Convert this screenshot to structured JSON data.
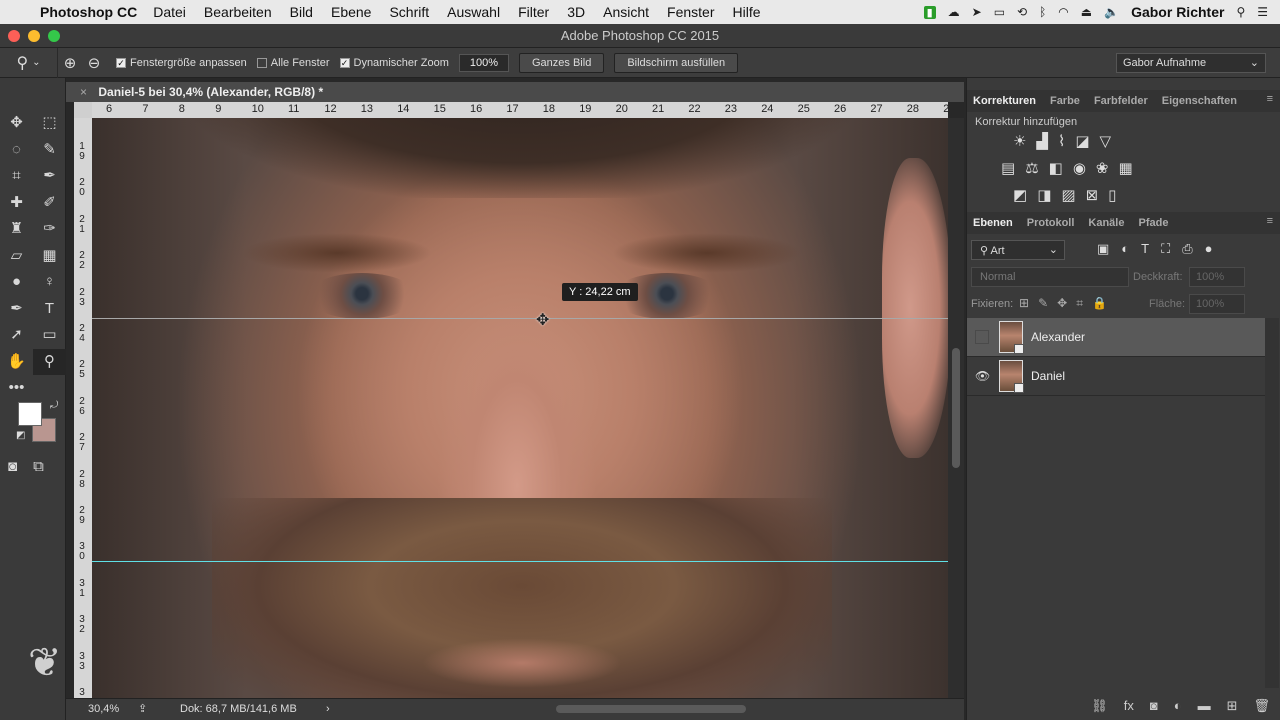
{
  "menubar": {
    "app": "Photoshop CC",
    "items": [
      "Datei",
      "Bearbeiten",
      "Bild",
      "Ebene",
      "Schrift",
      "Auswahl",
      "Filter",
      "3D",
      "Ansicht",
      "Fenster",
      "Hilfe"
    ],
    "user": "Gabor Richter"
  },
  "window": {
    "title": "Adobe Photoshop CC 2015"
  },
  "options": {
    "fit_window": "Fenstergröße anpassen",
    "all_windows": "Alle Fenster",
    "dynamic_zoom": "Dynamischer Zoom",
    "zoom_value": "100%",
    "fit_screen": "Ganzes Bild",
    "fill_screen": "Bildschirm ausfüllen",
    "workspace": "Gabor Aufnahme"
  },
  "document": {
    "tab_title": "Daniel-5 bei 30,4% (Alexander, RGB/8) *",
    "ruler_top": [
      "6",
      "7",
      "8",
      "9",
      "10",
      "11",
      "12",
      "13",
      "14",
      "15",
      "16",
      "17",
      "18",
      "19",
      "20",
      "21",
      "22",
      "23",
      "24",
      "25",
      "26",
      "27",
      "28",
      "29"
    ],
    "ruler_left": [
      "1 9",
      "2 0",
      "2 1",
      "2 2",
      "2 3",
      "2 4",
      "2 5",
      "2 6",
      "2 7",
      "2 8",
      "2 9",
      "3 0",
      "3 1",
      "3 2",
      "3 3",
      "3 4"
    ],
    "tooltip": "Y : 24,22 cm"
  },
  "status": {
    "zoom": "30,4%",
    "doc": "Dok: 68,7 MB/141,6 MB",
    "arrow": "›"
  },
  "panels": {
    "top_tabs": [
      "Korrekturen",
      "Farbe",
      "Farbfelder",
      "Eigenschaften"
    ],
    "adjust_title": "Korrektur hinzufügen",
    "layer_tabs": [
      "Ebenen",
      "Protokoll",
      "Kanäle",
      "Pfade"
    ],
    "filter_kind": "Art",
    "blend_mode": "Normal",
    "opacity_label": "Deckkraft:",
    "opacity_value": "100%",
    "lock_label": "Fixieren:",
    "fill_label": "Fläche:",
    "fill_value": "100%",
    "layers": [
      {
        "name": "Alexander",
        "visible": false,
        "selected": true
      },
      {
        "name": "Daniel",
        "visible": true,
        "selected": false
      }
    ]
  },
  "colors": {
    "foreground": "#ffffff",
    "background": "#b99690",
    "guide_active": "#5fe0e6"
  }
}
